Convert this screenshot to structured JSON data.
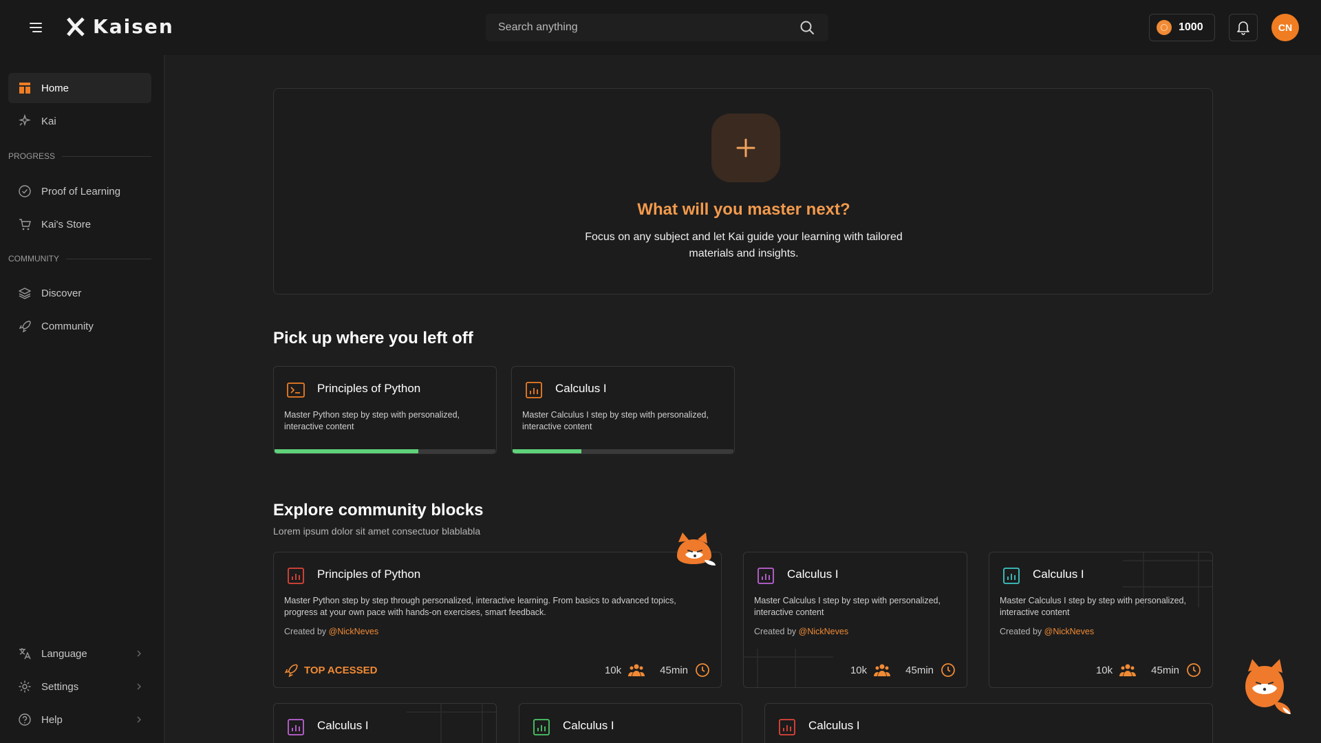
{
  "app": {
    "brand": "Kaisen"
  },
  "header": {
    "search_placeholder": "Search anything",
    "coins": "1000",
    "avatar_initials": "CN"
  },
  "sidebar": {
    "items_top": [
      {
        "label": "Home",
        "icon": "layout-icon",
        "active": true
      },
      {
        "label": "Kai",
        "icon": "sparkles-icon"
      }
    ],
    "progress_label": "PROGRESS",
    "progress_items": [
      {
        "label": "Proof of Learning",
        "icon": "check-circle-icon"
      },
      {
        "label": "Kai's Store",
        "icon": "cart-icon"
      }
    ],
    "community_label": "COMMUNITY",
    "community_items": [
      {
        "label": "Discover",
        "icon": "layers-icon"
      },
      {
        "label": "Community",
        "icon": "rocket-icon"
      }
    ],
    "bottom_items": [
      {
        "label": "Language",
        "icon": "translate-icon"
      },
      {
        "label": "Settings",
        "icon": "gear-icon"
      },
      {
        "label": "Help",
        "icon": "help-circle-icon"
      }
    ]
  },
  "hero": {
    "title": "What will you master next?",
    "text": "Focus on any subject and let Kai guide your learning with tailored materials and insights."
  },
  "continue": {
    "title": "Pick up where you left off",
    "cards": [
      {
        "title": "Principles of Python",
        "desc": "Master Python step by step with personalized, interactive content",
        "icon": "terminal-icon",
        "progress": 0.65
      },
      {
        "title": "Calculus I",
        "desc": "Master Calculus I step by step with personalized, interactive content",
        "icon": "chart-bar-icon",
        "progress": 0.31
      }
    ]
  },
  "explore": {
    "title": "Explore community blocks",
    "subtitle": "Lorem ipsum dolor sit amet consectuor blablabla",
    "created_by_prefix": "Created by",
    "cards": [
      {
        "title": "Principles of Python",
        "desc": "Master Python step by step through personalized, interactive learning. From basics to advanced topics, progress at your own pace with hands-on exercises, smart feedback.",
        "author": "@NickNeves",
        "badge": "TOP ACESSED",
        "users": "10k",
        "duration": "45min",
        "icon_color": "#e0453a"
      },
      {
        "title": "Calculus I",
        "desc": "Master Calculus I step by step with personalized, interactive content",
        "author": "@NickNeves",
        "users": "10k",
        "duration": "45min",
        "icon_color": "#c063d8"
      },
      {
        "title": "Calculus I",
        "desc": "Master Calculus I step by step with personalized, interactive content",
        "author": "@NickNeves",
        "users": "10k",
        "duration": "45min",
        "icon_color": "#3fc7c7"
      },
      {
        "title": "Calculus I",
        "icon_color": "#c063d8"
      },
      {
        "title": "Calculus I",
        "icon_color": "#4cc96a"
      },
      {
        "title": "Calculus I",
        "icon_color": "#e0453a"
      }
    ]
  },
  "colors": {
    "accent": "#f08a35",
    "progress": "#5fd27a"
  }
}
